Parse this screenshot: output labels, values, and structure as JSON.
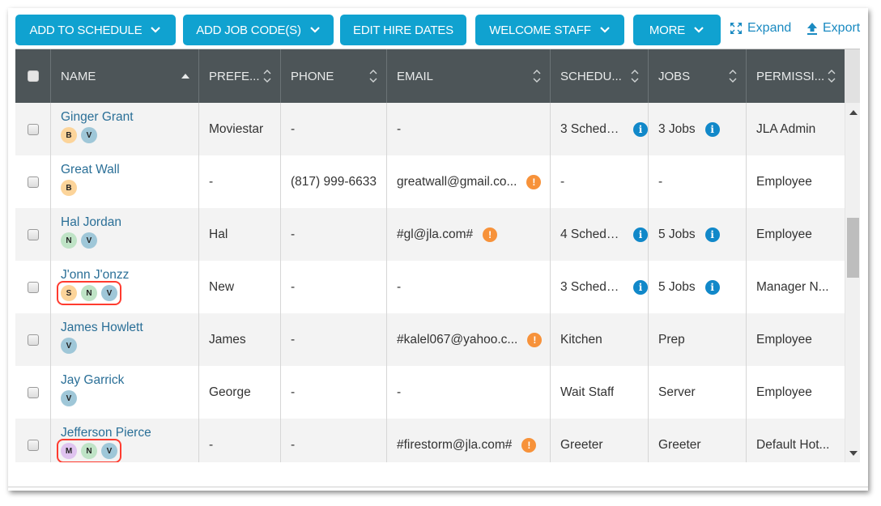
{
  "toolbar": {
    "buttons": [
      {
        "label": "ADD TO SCHEDULE",
        "has_dropdown": true
      },
      {
        "label": "ADD JOB CODE(S)",
        "has_dropdown": true
      },
      {
        "label": "EDIT HIRE DATES",
        "has_dropdown": false
      },
      {
        "label": "WELCOME STAFF",
        "has_dropdown": true
      },
      {
        "label": "MORE",
        "has_dropdown": true
      }
    ],
    "expand_label": "Expand",
    "export_label": "Export",
    "accent_color": "#10a2d0"
  },
  "table": {
    "columns": [
      {
        "label": "",
        "key": "select"
      },
      {
        "label": "NAME",
        "sort": "ascending"
      },
      {
        "label": "PREFE...",
        "sort": "none"
      },
      {
        "label": "PHONE",
        "sort": "none"
      },
      {
        "label": "EMAIL",
        "sort": "none"
      },
      {
        "label": "SCHEDU...",
        "sort": "none"
      },
      {
        "label": "JOBS",
        "sort": "none"
      },
      {
        "label": "PERMISSI...",
        "sort": "none"
      }
    ],
    "rows": [
      {
        "name": "Ginger Grant",
        "badges": [
          "B",
          "V"
        ],
        "highlight": false,
        "preferred": "Moviestar",
        "phone": "-",
        "email": "-",
        "email_warning": false,
        "schedules": "3 Schedu...",
        "schedules_info": true,
        "jobs": "3 Jobs",
        "jobs_info": true,
        "permission": "JLA Admin"
      },
      {
        "name": "Great Wall",
        "badges": [
          "B"
        ],
        "highlight": false,
        "preferred": "-",
        "phone": "(817) 999-6633",
        "email": "greatwall@gmail.co...",
        "email_warning": true,
        "schedules": "-",
        "schedules_info": false,
        "jobs": "-",
        "jobs_info": false,
        "permission": "Employee"
      },
      {
        "name": "Hal Jordan",
        "badges": [
          "N",
          "V"
        ],
        "highlight": false,
        "preferred": "Hal",
        "phone": "-",
        "email": "#gl@jla.com#",
        "email_warning": true,
        "schedules": "4 Schedu...",
        "schedules_info": true,
        "jobs": "5 Jobs",
        "jobs_info": true,
        "permission": "Employee"
      },
      {
        "name": "J'onn J'onzz",
        "badges": [
          "S",
          "N",
          "V"
        ],
        "highlight": true,
        "preferred": "New",
        "phone": "-",
        "email": "-",
        "email_warning": false,
        "schedules": "3 Schedu...",
        "schedules_info": true,
        "jobs": "5 Jobs",
        "jobs_info": true,
        "permission": "Manager N..."
      },
      {
        "name": "James Howlett",
        "badges": [
          "V"
        ],
        "highlight": false,
        "preferred": "James",
        "phone": "-",
        "email": "#kalel067@yahoo.c...",
        "email_warning": true,
        "schedules": "Kitchen",
        "schedules_info": false,
        "jobs": "Prep",
        "jobs_info": false,
        "permission": "Employee"
      },
      {
        "name": "Jay Garrick",
        "badges": [
          "V"
        ],
        "highlight": false,
        "preferred": "George",
        "phone": "-",
        "email": "-",
        "email_warning": false,
        "schedules": "Wait Staff",
        "schedules_info": false,
        "jobs": "Server",
        "jobs_info": false,
        "permission": "Employee"
      },
      {
        "name": "Jefferson Pierce",
        "badges": [
          "M",
          "N",
          "V"
        ],
        "highlight": true,
        "preferred": "-",
        "phone": "-",
        "email": "#firestorm@jla.com#",
        "email_warning": true,
        "schedules": "Greeter",
        "schedules_info": false,
        "jobs": "Greeter",
        "jobs_info": false,
        "permission": "Default Hot..."
      }
    ],
    "badge_colors": {
      "B": "#fcd49a",
      "S": "#fcd49a",
      "N": "#bfe3c6",
      "V": "#9fc7d8",
      "M": "#dfc3ef"
    },
    "info_icon_color": "#1188c9",
    "warning_icon_color": "#f7923a",
    "highlight_color": "#ff3b2f"
  },
  "scrollbar": {
    "position_fraction": 0.45
  }
}
